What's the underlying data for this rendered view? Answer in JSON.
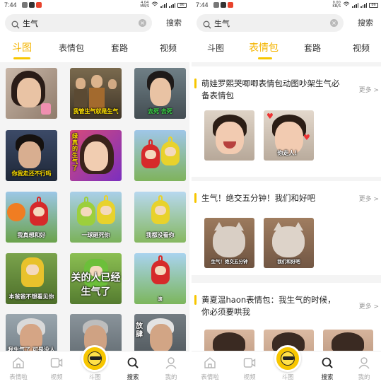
{
  "colors": {
    "accent": "#f7c600",
    "active_tab": "#f4b400"
  },
  "left": {
    "status": {
      "time": "7:44",
      "net": "4.04\nMB/S",
      "battery": "86"
    },
    "search": {
      "query": "生气",
      "button": "搜索"
    },
    "tabs": [
      {
        "label": "斗图",
        "active": true
      },
      {
        "label": "表情包",
        "active": false
      },
      {
        "label": "套路",
        "active": false
      },
      {
        "label": "视频",
        "active": false
      }
    ],
    "grid": [
      {
        "caption": "",
        "icon": "woman-portrait"
      },
      {
        "caption": "我管生气就是生气",
        "icon": "tv-scene"
      },
      {
        "caption": "去死 去死",
        "icon": "man-shouting"
      },
      {
        "caption": "你我走还不行吗",
        "icon": "man-looking-down"
      },
      {
        "caption": "绿真的生气了",
        "icon": "woman-smiling"
      },
      {
        "caption": "",
        "icon": "teletubbies-pair"
      },
      {
        "caption": "我真想和好",
        "icon": "teletubbies-field"
      },
      {
        "caption": "一球砸死你",
        "icon": "teletubby-ball"
      },
      {
        "caption": "我都没看你",
        "icon": "teletubbies-duo"
      },
      {
        "caption": "本爸爸不想看见你",
        "icon": "teletubby-laa-laa"
      },
      {
        "caption": "关的人已经生气了",
        "icon": "teletubby-close"
      },
      {
        "caption": "滚",
        "icon": "teletubby-green"
      },
      {
        "caption": "我生气了 可是没人哄我",
        "icon": "teletubby-po"
      },
      {
        "caption": "",
        "icon": "old-man-1"
      },
      {
        "caption": "",
        "icon": "old-man-2"
      },
      {
        "caption": "放肆",
        "icon": "old-man-3"
      }
    ],
    "nav": [
      {
        "label": "表情啦",
        "icon": "home-icon",
        "active": false
      },
      {
        "label": "视频",
        "icon": "video-icon",
        "active": false
      },
      {
        "label": "斗图",
        "icon": "emoji-center-icon",
        "active": false
      },
      {
        "label": "搜索",
        "icon": "search-icon",
        "active": true
      },
      {
        "label": "我的",
        "icon": "profile-icon",
        "active": false
      }
    ]
  },
  "right": {
    "status": {
      "time": "7:44",
      "net": "0.00\nKB/S",
      "battery": "86"
    },
    "search": {
      "query": "生气",
      "button": "搜索"
    },
    "tabs": [
      {
        "label": "斗图",
        "active": false
      },
      {
        "label": "表情包",
        "active": true
      },
      {
        "label": "套路",
        "active": false
      },
      {
        "label": "视频",
        "active": false
      }
    ],
    "sections": [
      {
        "title": "萌娃罗熙哭唧唧表情包动图吵架生气必备表情包",
        "more": "更多 >",
        "captions": [
          "",
          "你走人！"
        ]
      },
      {
        "title": "生气！绝交五分钟！我们和好吧",
        "more": "更多 >",
        "captions": [
          "生气！绝交五分钟",
          "我们和好吧"
        ]
      },
      {
        "title": "黄夏温haon表情包：我生气的时候，你必须要哄我",
        "more": "更多 >",
        "captions": [
          "",
          "",
          ""
        ]
      }
    ],
    "nav": [
      {
        "label": "表情啦",
        "icon": "home-icon",
        "active": false
      },
      {
        "label": "视频",
        "icon": "video-icon",
        "active": false
      },
      {
        "label": "斗图",
        "icon": "emoji-center-icon",
        "active": false
      },
      {
        "label": "搜索",
        "icon": "search-icon",
        "active": true
      },
      {
        "label": "我的",
        "icon": "profile-icon",
        "active": false
      }
    ]
  }
}
